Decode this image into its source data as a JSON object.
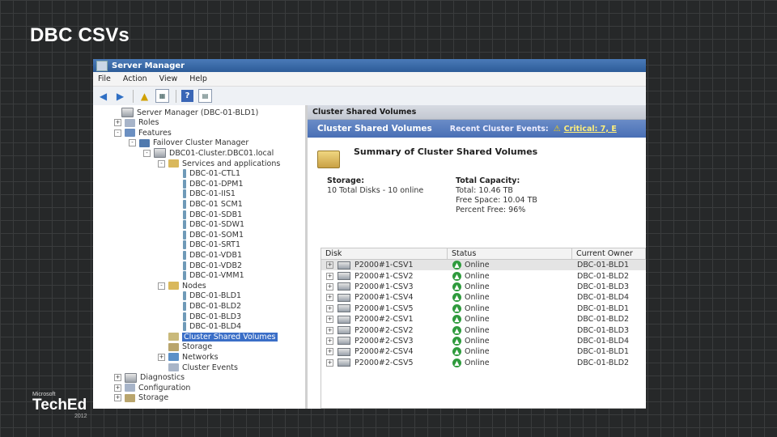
{
  "slide": {
    "title": "DBC CSVs",
    "logo": {
      "microsoft": "Microsoft",
      "teched": "TechEd",
      "year": "2012"
    }
  },
  "window": {
    "title": "Server Manager",
    "menu": [
      "File",
      "Action",
      "View",
      "Help"
    ],
    "toolbar_icons": [
      "back-arrow-icon",
      "forward-arrow-icon",
      "up-folder-icon",
      "show-hide-tree-icon",
      "help-icon",
      "properties-icon"
    ]
  },
  "tree": [
    {
      "label": "Server Manager (DBC-01-BLD1)",
      "icon": "server-icon",
      "expander": "",
      "indent": 0
    },
    {
      "label": "Roles",
      "icon": "roles-icon",
      "expander": "+",
      "indent": 1
    },
    {
      "label": "Features",
      "icon": "features-icon",
      "expander": "-",
      "indent": 1
    },
    {
      "label": "Failover Cluster Manager",
      "icon": "cluster-manager-icon",
      "expander": "-",
      "indent": 2
    },
    {
      "label": "DBC01-Cluster.DBC01.local",
      "icon": "cluster-icon",
      "expander": "-",
      "indent": 3
    },
    {
      "label": "Services and applications",
      "icon": "folder-icon",
      "expander": "-",
      "indent": 4
    },
    {
      "label": "DBC-01-CTL1",
      "icon": "service-icon",
      "expander": "",
      "indent": 5
    },
    {
      "label": "DBC-01-DPM1",
      "icon": "service-icon",
      "expander": "",
      "indent": 5
    },
    {
      "label": "DBC-01-IIS1",
      "icon": "service-icon",
      "expander": "",
      "indent": 5
    },
    {
      "label": "DBC-01 SCM1",
      "icon": "service-icon",
      "expander": "",
      "indent": 5
    },
    {
      "label": "DBC-01-SDB1",
      "icon": "service-icon",
      "expander": "",
      "indent": 5
    },
    {
      "label": "DBC-01-SDW1",
      "icon": "service-icon",
      "expander": "",
      "indent": 5
    },
    {
      "label": "DBC-01-SOM1",
      "icon": "service-icon",
      "expander": "",
      "indent": 5
    },
    {
      "label": "DBC-01-SRT1",
      "icon": "service-icon",
      "expander": "",
      "indent": 5
    },
    {
      "label": "DBC-01-VDB1",
      "icon": "service-icon",
      "expander": "",
      "indent": 5
    },
    {
      "label": "DBC-01-VDB2",
      "icon": "service-icon",
      "expander": "",
      "indent": 5
    },
    {
      "label": "DBC-01-VMM1",
      "icon": "service-icon",
      "expander": "",
      "indent": 5
    },
    {
      "label": "Nodes",
      "icon": "folder-icon",
      "expander": "-",
      "indent": 4
    },
    {
      "label": "DBC-01-BLD1",
      "icon": "service-icon",
      "expander": "",
      "indent": 5
    },
    {
      "label": "DBC-01-BLD2",
      "icon": "service-icon",
      "expander": "",
      "indent": 5
    },
    {
      "label": "DBC-01-BLD3",
      "icon": "service-icon",
      "expander": "",
      "indent": 5
    },
    {
      "label": "DBC-01-BLD4",
      "icon": "service-icon",
      "expander": "",
      "indent": 5
    },
    {
      "label": "Cluster Shared Volumes",
      "icon": "csv-icon",
      "expander": "",
      "indent": 4,
      "selected": true
    },
    {
      "label": "Storage",
      "icon": "storage-icon",
      "expander": "",
      "indent": 4
    },
    {
      "label": "Networks",
      "icon": "network-icon",
      "expander": "+",
      "indent": 4
    },
    {
      "label": "Cluster Events",
      "icon": "events-icon",
      "expander": "",
      "indent": 4
    },
    {
      "label": "Diagnostics",
      "icon": "diagnostics-icon",
      "expander": "+",
      "indent": 1
    },
    {
      "label": "Configuration",
      "icon": "configuration-icon",
      "expander": "+",
      "indent": 1
    },
    {
      "label": "Storage",
      "icon": "storage-icon",
      "expander": "+",
      "indent": 1
    }
  ],
  "pane": {
    "header": "Cluster Shared Volumes",
    "subheader": "Cluster Shared Volumes",
    "recent_events_label": "Recent Cluster Events:",
    "critical_link": "Critical: 7, E",
    "summary_title": "Summary of Cluster Shared Volumes",
    "storage_label": "Storage:",
    "storage_value": "10 Total Disks - 10 online",
    "capacity_label": "Total Capacity:",
    "total": "Total: 10.46 TB",
    "free": "Free Space: 10.04 TB",
    "percent": "Percent Free: 96%"
  },
  "table": {
    "columns": [
      "Disk",
      "Status",
      "Current Owner"
    ],
    "rows": [
      {
        "disk": "P2000#1-CSV1",
        "status": "Online",
        "owner": "DBC-01-BLD1"
      },
      {
        "disk": "P2000#1-CSV2",
        "status": "Online",
        "owner": "DBC-01-BLD2"
      },
      {
        "disk": "P2000#1-CSV3",
        "status": "Online",
        "owner": "DBC-01-BLD3"
      },
      {
        "disk": "P2000#1-CSV4",
        "status": "Online",
        "owner": "DBC-01-BLD4"
      },
      {
        "disk": "P2000#1-CSV5",
        "status": "Online",
        "owner": "DBC-01-BLD1"
      },
      {
        "disk": "P2000#2-CSV1",
        "status": "Online",
        "owner": "DBC-01-BLD2"
      },
      {
        "disk": "P2000#2-CSV2",
        "status": "Online",
        "owner": "DBC-01-BLD3"
      },
      {
        "disk": "P2000#2-CSV3",
        "status": "Online",
        "owner": "DBC-01-BLD4"
      },
      {
        "disk": "P2000#2-CSV4",
        "status": "Online",
        "owner": "DBC-01-BLD1"
      },
      {
        "disk": "P2000#2-CSV5",
        "status": "Online",
        "owner": "DBC-01-BLD2"
      }
    ]
  }
}
